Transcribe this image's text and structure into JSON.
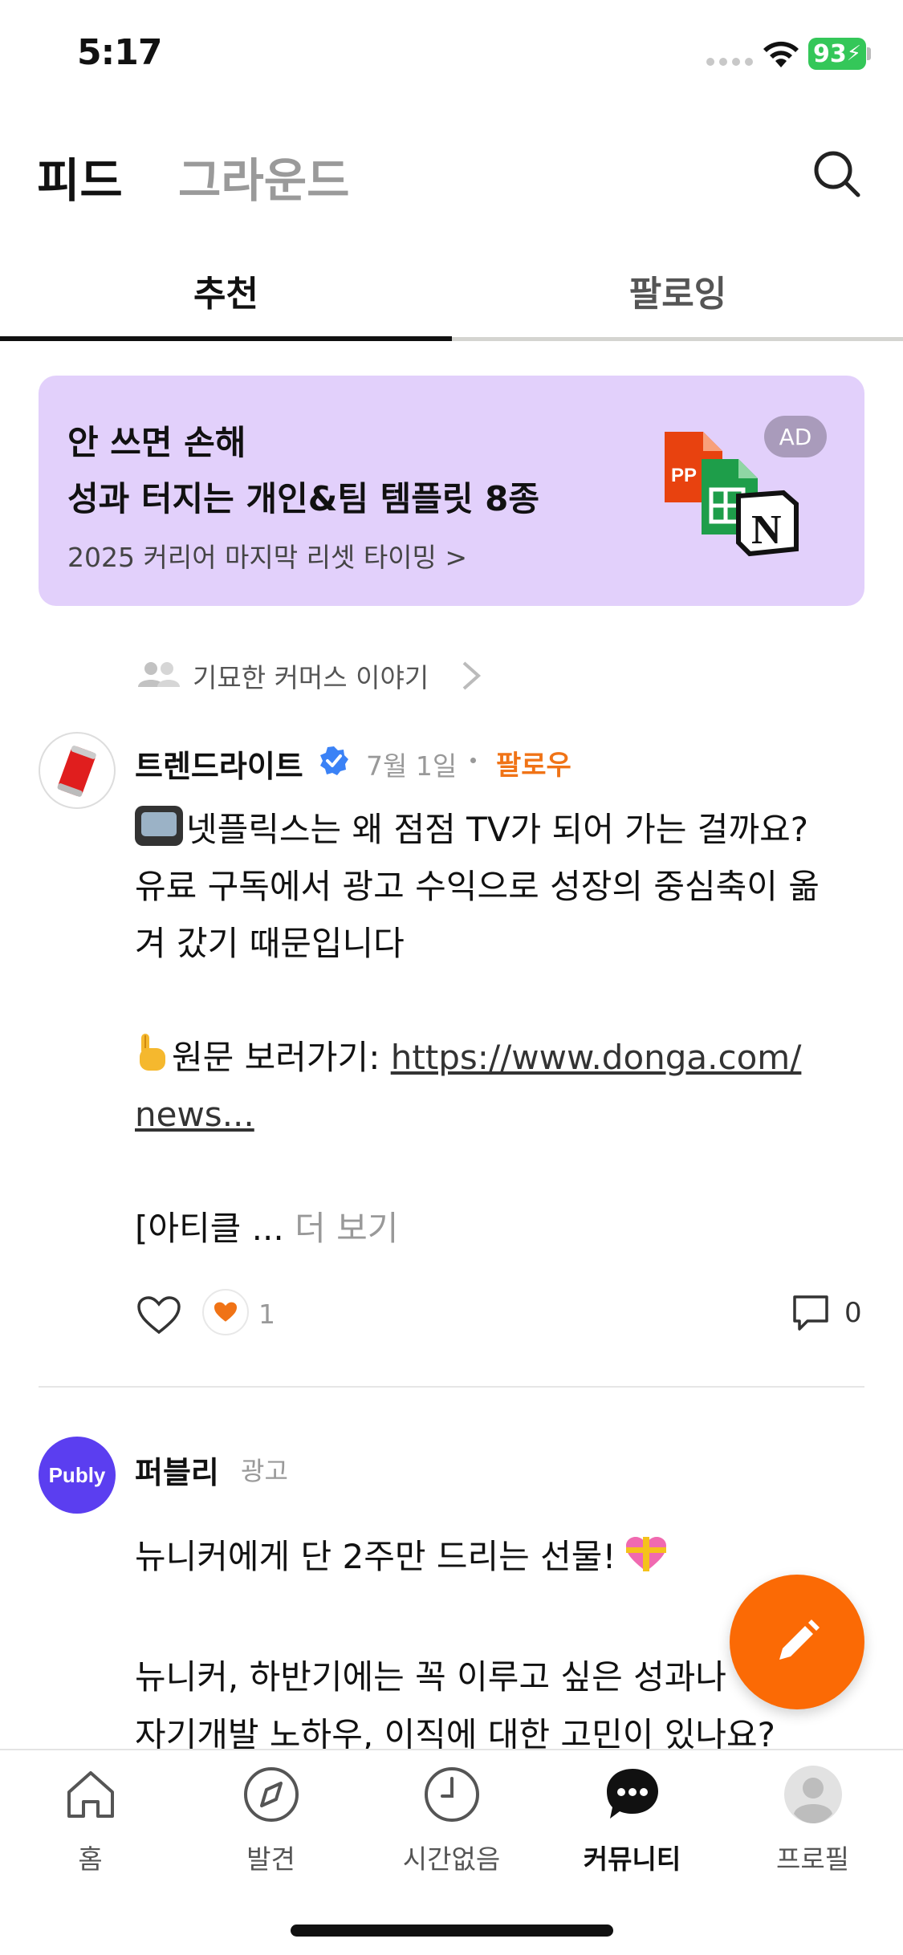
{
  "status_bar": {
    "time": "5:17",
    "battery": "93"
  },
  "header": {
    "title": "피드",
    "secondary": "그라운드"
  },
  "tabs": [
    {
      "label": "추천"
    },
    {
      "label": "팔로잉"
    }
  ],
  "ad_banner": {
    "line1": "안 쓰면 손해",
    "line2": "성과 터지는 개인&팀 템플릿 8종",
    "line3": "2025 커리어 마지막 리셋 타이밍 >",
    "badge": "AD",
    "art_label": "PP"
  },
  "community": {
    "name": "기묘한 커머스 이야기"
  },
  "post1": {
    "author": "트렌드라이트",
    "date": "7월 1일",
    "follow": "팔로우",
    "line1": "넷플릭스는 왜 점점 TV가 되어 가는 걸까요?",
    "line2": "유료 구독에서 광고 수익으로 성장의 중심축이 옮",
    "line3": "겨 갔기 때문입니다",
    "link_prefix": "원문 보러가기: ",
    "link1": "https://www.donga.com/",
    "link2": "news...",
    "truncated": "[아티클 ...",
    "more": "더 보기",
    "reaction_count": "1",
    "comment_count": "0"
  },
  "post2": {
    "author": "퍼블리",
    "ad_label": "광고",
    "avatar_text": "Publy",
    "line1": "뉴니커에게 단 2주만 드리는 선물!",
    "line2": "뉴니커, 하반기에는 꼭 이루고 싶은 성과나",
    "line3": "자기개발 노하우, 이직에 대한 고민이 있나요?"
  },
  "bottom_nav": [
    {
      "label": "홈"
    },
    {
      "label": "발견"
    },
    {
      "label": "시간없음"
    },
    {
      "label": "커뮤니티"
    },
    {
      "label": "프로필"
    }
  ]
}
